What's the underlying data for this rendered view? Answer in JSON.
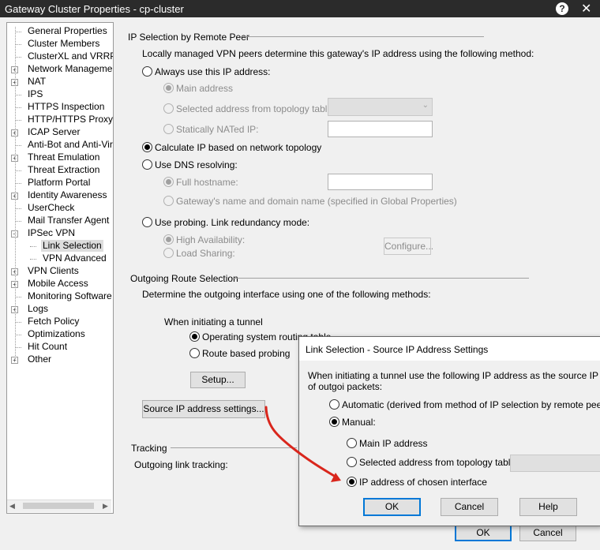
{
  "window": {
    "title": "Gateway Cluster Properties - cp-cluster"
  },
  "tree": [
    {
      "label": "General Properties",
      "expandable": false,
      "level": 0
    },
    {
      "label": "Cluster Members",
      "expandable": false,
      "level": 0
    },
    {
      "label": "ClusterXL and VRRP",
      "expandable": false,
      "level": 0
    },
    {
      "label": "Network Management",
      "expandable": true,
      "level": 0
    },
    {
      "label": "NAT",
      "expandable": true,
      "level": 0
    },
    {
      "label": "IPS",
      "expandable": false,
      "level": 0
    },
    {
      "label": "HTTPS Inspection",
      "expandable": false,
      "level": 0
    },
    {
      "label": "HTTP/HTTPS Proxy",
      "expandable": false,
      "level": 0
    },
    {
      "label": "ICAP Server",
      "expandable": true,
      "level": 0
    },
    {
      "label": "Anti-Bot and Anti-Virus",
      "expandable": false,
      "level": 0
    },
    {
      "label": "Threat Emulation",
      "expandable": true,
      "level": 0
    },
    {
      "label": "Threat Extraction",
      "expandable": false,
      "level": 0
    },
    {
      "label": "Platform Portal",
      "expandable": false,
      "level": 0
    },
    {
      "label": "Identity Awareness",
      "expandable": true,
      "level": 0
    },
    {
      "label": "UserCheck",
      "expandable": false,
      "level": 0
    },
    {
      "label": "Mail Transfer Agent",
      "expandable": false,
      "level": 0
    },
    {
      "label": "IPSec VPN",
      "expandable": true,
      "expanded": true,
      "level": 0
    },
    {
      "label": "Link Selection",
      "expandable": false,
      "level": 1,
      "selected": true
    },
    {
      "label": "VPN Advanced",
      "expandable": false,
      "level": 1
    },
    {
      "label": "VPN Clients",
      "expandable": true,
      "level": 0
    },
    {
      "label": "Mobile Access",
      "expandable": true,
      "level": 0
    },
    {
      "label": "Monitoring Software bla",
      "expandable": false,
      "level": 0
    },
    {
      "label": "Logs",
      "expandable": true,
      "level": 0
    },
    {
      "label": "Fetch Policy",
      "expandable": false,
      "level": 0
    },
    {
      "label": "Optimizations",
      "expandable": false,
      "level": 0
    },
    {
      "label": "Hit Count",
      "expandable": false,
      "level": 0
    },
    {
      "label": "Other",
      "expandable": true,
      "level": 0
    }
  ],
  "ip_selection": {
    "title": "IP Selection by Remote Peer",
    "description": "Locally managed VPN peers determine this gateway's IP address using the following method:",
    "always_use": "Always use this IP address:",
    "main_address": "Main address",
    "selected_topology": "Selected address from topology table:",
    "static_nat": "Statically NATed IP:",
    "calculate": "Calculate IP based on network topology",
    "use_dns": "Use DNS resolving:",
    "full_hostname": "Full hostname:",
    "gateway_name": "Gateway's name and domain name (specified in Global Properties)",
    "use_probing": "Use probing. Link redundancy mode:",
    "high_availability": "High Availability:",
    "load_sharing": "Load Sharing:",
    "configure": "Configure..."
  },
  "outgoing": {
    "title": "Outgoing Route Selection",
    "description": "Determine the outgoing interface using one of the following methods:",
    "when_initiating": "When initiating a tunnel",
    "os_routing": "Operating system routing table",
    "route_probing": "Route based probing",
    "setup": "Setup...",
    "source_ip_button": "Source IP address settings..."
  },
  "tracking": {
    "title": "Tracking",
    "outgoing_link": "Outgoing link tracking:"
  },
  "footer": {
    "ok": "OK",
    "cancel": "Cancel"
  },
  "dialog": {
    "title": "Link Selection - Source IP Address Settings",
    "description": "When initiating a tunnel use the following IP address as the source IP of outgoi packets:",
    "automatic": "Automatic (derived from method of IP selection by remote peer)",
    "manual": "Manual:",
    "main_ip": "Main IP address",
    "selected_topology": "Selected address from topology table:",
    "chosen_interface": "IP address of chosen interface",
    "ok": "OK",
    "cancel": "Cancel",
    "help": "Help"
  },
  "colors": {
    "arrow": "#d9261c",
    "default_button_border": "#0078d7",
    "titlebar": "#2b2b2b"
  }
}
